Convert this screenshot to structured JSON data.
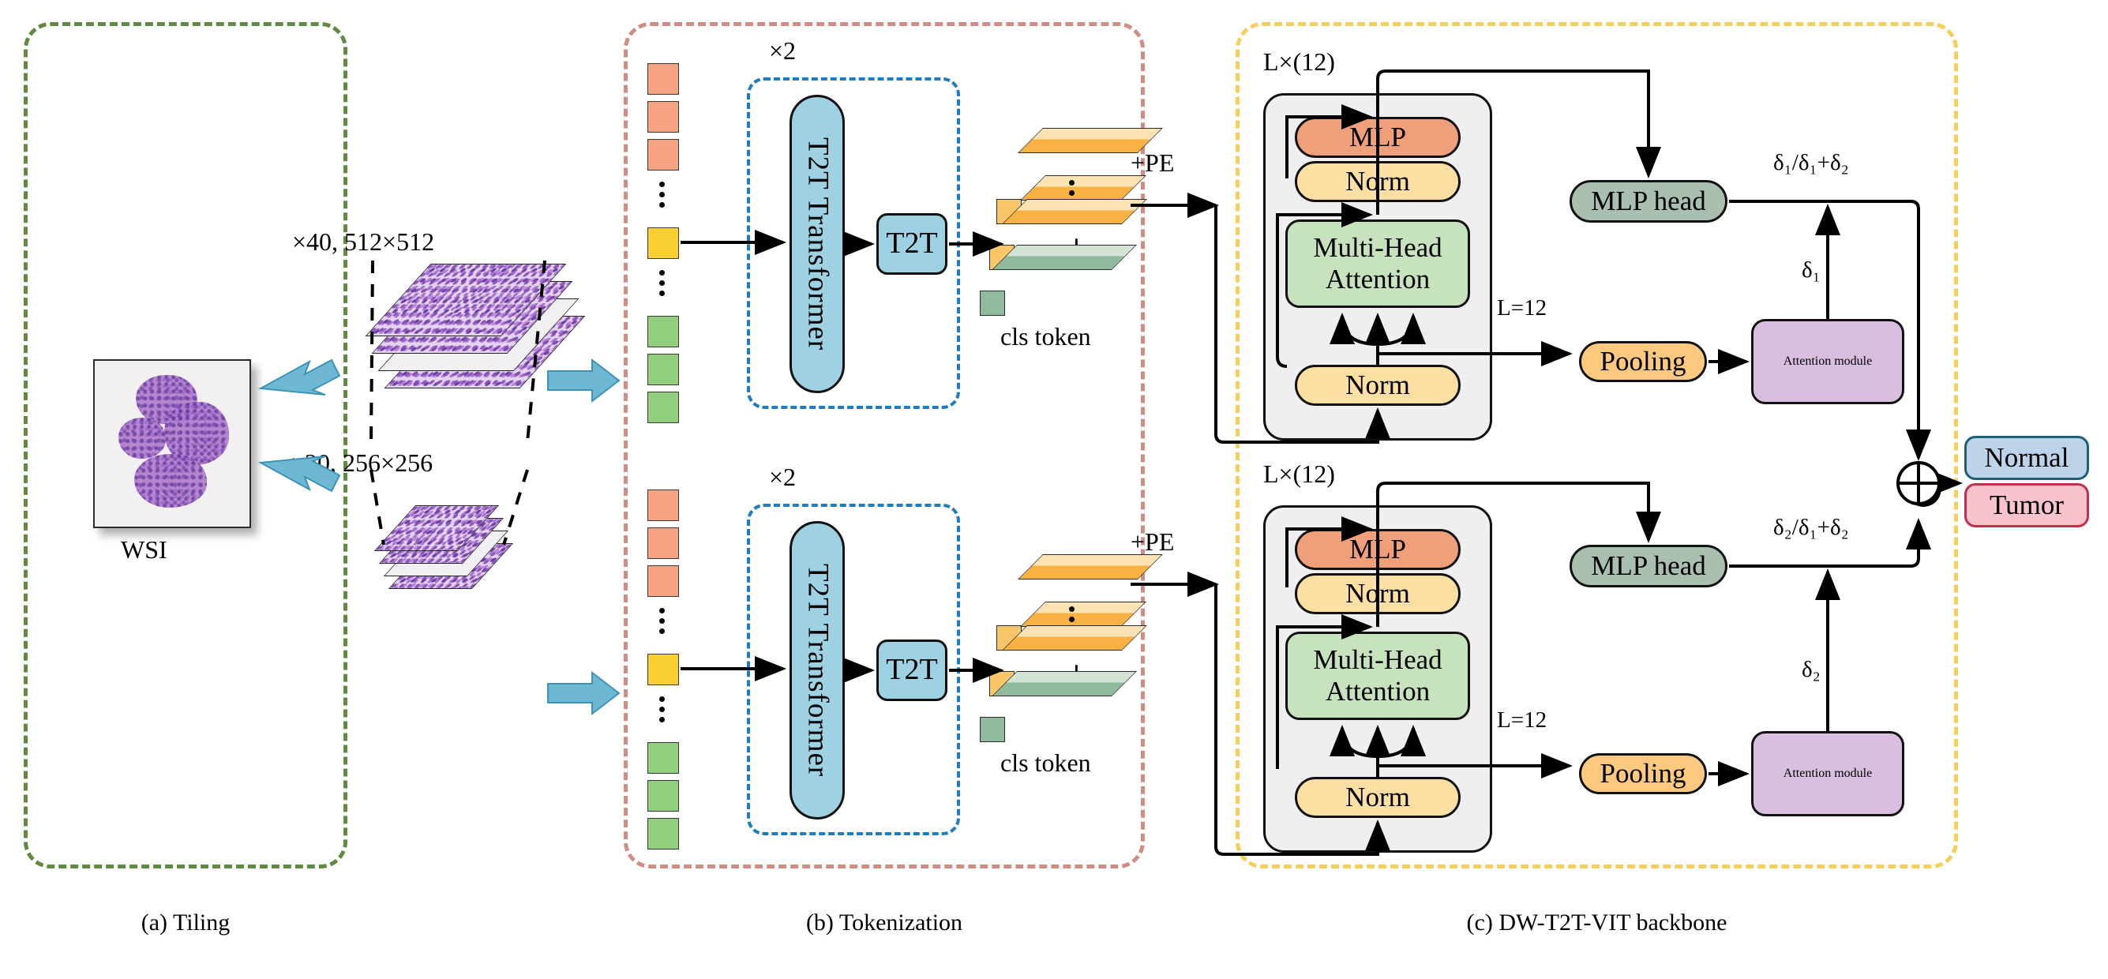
{
  "figure": {
    "captions": [
      {
        "id": "a",
        "text": "(a) Tiling"
      },
      {
        "id": "b",
        "text": "(b) Tokenization"
      },
      {
        "id": "c",
        "text": "(c) DW-T2T-VIT backbone"
      }
    ]
  },
  "tiling": {
    "wsi_label": "WSI",
    "magnifications": [
      {
        "label": "×40, 512×512"
      },
      {
        "label": "×20, 256×256"
      }
    ]
  },
  "tokenization": {
    "repeat_label": "×2",
    "transformer_label": "T2T Transformer",
    "t2t_label": "T2T",
    "cls_token_label": "cls token",
    "pe_label": "+PE",
    "branches": [
      {
        "repeat_label": "×2",
        "transformer_label": "T2T Transformer",
        "t2t_label": "T2T",
        "cls_token_label": "cls token",
        "pe_label": "+PE"
      },
      {
        "repeat_label": "×2",
        "transformer_label": "T2T Transformer",
        "t2t_label": "T2T",
        "cls_token_label": "cls token",
        "pe_label": "+PE"
      }
    ]
  },
  "backbone": {
    "branches": [
      {
        "depth_label": "L×(12)",
        "mlp_label": "MLP",
        "norm_top_label": "Norm",
        "attention_label": "Multi-Head Attention",
        "norm_bottom_label": "Norm",
        "layer_label": "L=12",
        "mlp_head_label": "MLP head",
        "pooling_label": "Pooling",
        "attention_module_label": "Attention module",
        "weight_label": "δ₁/δ₁+δ₂",
        "delta_label": "δ₁"
      },
      {
        "depth_label": "L×(12)",
        "mlp_label": "MLP",
        "norm_top_label": "Norm",
        "attention_label": "Multi-Head Attention",
        "norm_bottom_label": "Norm",
        "layer_label": "L=12",
        "mlp_head_label": "MLP head",
        "pooling_label": "Pooling",
        "attention_module_label": "Attention module",
        "weight_label": "δ₂/δ₁+δ₂",
        "delta_label": "δ₂"
      }
    ],
    "sum_symbol": "⊕",
    "outputs": [
      {
        "label": "Normal",
        "color": "#bcd3ea"
      },
      {
        "label": "Tumor",
        "color": "#f9c3cd"
      }
    ]
  },
  "colors": {
    "frame_a": "#5f8a3f",
    "frame_b": "#d08d86",
    "frame_c": "#f6cf5a",
    "dashdot_blue": "#1f7cc0",
    "token_salmon": "#f6a383",
    "token_yellow": "#fbd032",
    "token_green": "#92d07f",
    "t2t_blue": "#9ed2e3",
    "mlp": "#efa07a",
    "norm": "#fddfa4",
    "attention": "#c6e3bd",
    "mlp_head": "#a9bfb0",
    "pooling": "#fcc97e",
    "attention_module": "#d8bfe0",
    "arrow_blue": "#6fb8d4"
  }
}
